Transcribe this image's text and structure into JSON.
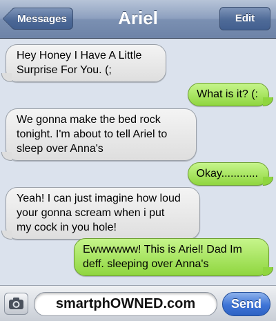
{
  "navbar": {
    "back_label": "Messages",
    "title": "Ariel",
    "edit_label": "Edit"
  },
  "messages": [
    {
      "side": "received",
      "text": "Hey Honey I Have A Little\nSurprise For You. (;"
    },
    {
      "side": "sent",
      "text": "What is it? (:"
    },
    {
      "side": "received",
      "text": "We gonna make the bed rock\ntonight. I'm about to tell Ariel to\nsleep over Anna's"
    },
    {
      "side": "sent",
      "text": "Okay............"
    },
    {
      "side": "received",
      "text": "Yeah! I can just imagine how loud\nyour gonna scream when i put\nmy cock in you hole!"
    },
    {
      "side": "sent",
      "text": "Ewwwwww! This is Ariel! Dad Im\ndeff. sleeping over Anna's"
    }
  ],
  "toolbar": {
    "camera_icon": "camera-icon",
    "input_value": "smartphOWNED.com",
    "send_label": "Send"
  },
  "colors": {
    "sent_bubble": "#8fd63f",
    "received_bubble": "#dedede",
    "navbar": "#7b90b2",
    "send_button": "#3e74d6"
  }
}
